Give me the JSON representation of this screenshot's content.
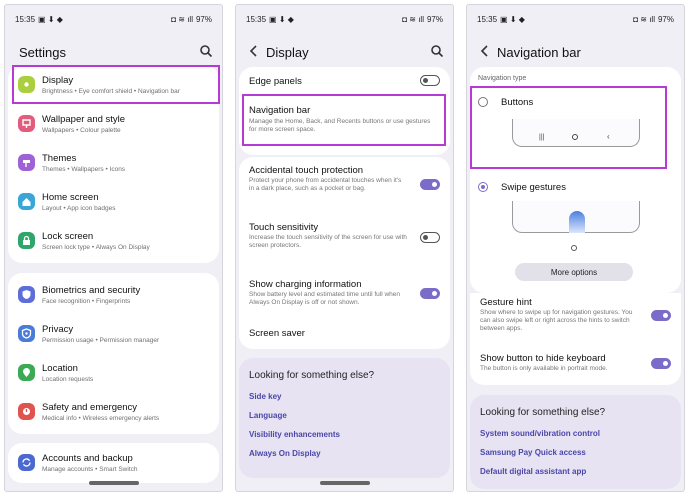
{
  "status": {
    "time": "15:35",
    "battery": "97%"
  },
  "screen1": {
    "title": "Settings",
    "items": [
      {
        "label": "Display",
        "sub": "Brightness  •  Eye comfort shield  •  Navigation bar",
        "icon": "sun-icon",
        "color": "#a9cf3f"
      },
      {
        "label": "Wallpaper and style",
        "sub": "Wallpapers  •  Colour palette",
        "icon": "palette-icon",
        "color": "#e25c7d"
      },
      {
        "label": "Themes",
        "sub": "Themes  •  Wallpapers  •  Icons",
        "icon": "themes-icon",
        "color": "#9f62d6"
      },
      {
        "label": "Home screen",
        "sub": "Layout  •  App icon badges",
        "icon": "home-icon",
        "color": "#39a6d8"
      },
      {
        "label": "Lock screen",
        "sub": "Screen lock type  •  Always On Display",
        "icon": "lock-icon",
        "color": "#2ea56b"
      },
      {
        "label": "Biometrics and security",
        "sub": "Face recognition  •  Fingerprints",
        "icon": "shield-icon",
        "color": "#5d6ed8"
      },
      {
        "label": "Privacy",
        "sub": "Permission usage  •  Permission manager",
        "icon": "privacy-icon",
        "color": "#4b7bd8"
      },
      {
        "label": "Location",
        "sub": "Location requests",
        "icon": "location-icon",
        "color": "#3aaa55"
      },
      {
        "label": "Safety and emergency",
        "sub": "Medical info  •  Wireless emergency alerts",
        "icon": "emergency-icon",
        "color": "#e0544f"
      },
      {
        "label": "Accounts and backup",
        "sub": "Manage accounts  •  Smart Switch",
        "icon": "sync-icon",
        "color": "#4b69cf"
      }
    ]
  },
  "screen2": {
    "title": "Display",
    "edge_panels": "Edge panels",
    "navigation_bar": "Navigation bar",
    "navigation_bar_sub": "Manage the Home, Back, and Recents buttons or use gestures for more screen space.",
    "accidental": "Accidental touch protection",
    "accidental_sub": "Protect your phone from accidental touches when it's in a dark place, such as a pocket or bag.",
    "touch": "Touch sensitivity",
    "touch_sub": "Increase the touch sensitivity of the screen for use with screen protectors.",
    "charging": "Show charging information",
    "charging_sub": "Show battery level and estimated time until full when Always On Display is off or not shown.",
    "saver": "Screen saver",
    "look_title": "Looking for something else?",
    "links": [
      "Side key",
      "Language",
      "Visibility enhancements",
      "Always On Display"
    ]
  },
  "screen3": {
    "title": "Navigation bar",
    "nav_type": "Navigation type",
    "buttons": "Buttons",
    "swipe": "Swipe gestures",
    "more": "More options",
    "gesture_hint": "Gesture hint",
    "gesture_hint_sub": "Show where to swipe up for navigation gestures. You can also swipe left or right across the hints to switch between apps.",
    "hide_kb": "Show button to hide keyboard",
    "hide_kb_sub": "The button is only available in portrait mode.",
    "look_title": "Looking for something else?",
    "links": [
      "System sound/vibration control",
      "Samsung Pay Quick access",
      "Default digital assistant app"
    ]
  },
  "colors": {
    "highlight": "#b83ad6",
    "accent": "#7b6cc9",
    "link": "#4a46a8"
  }
}
